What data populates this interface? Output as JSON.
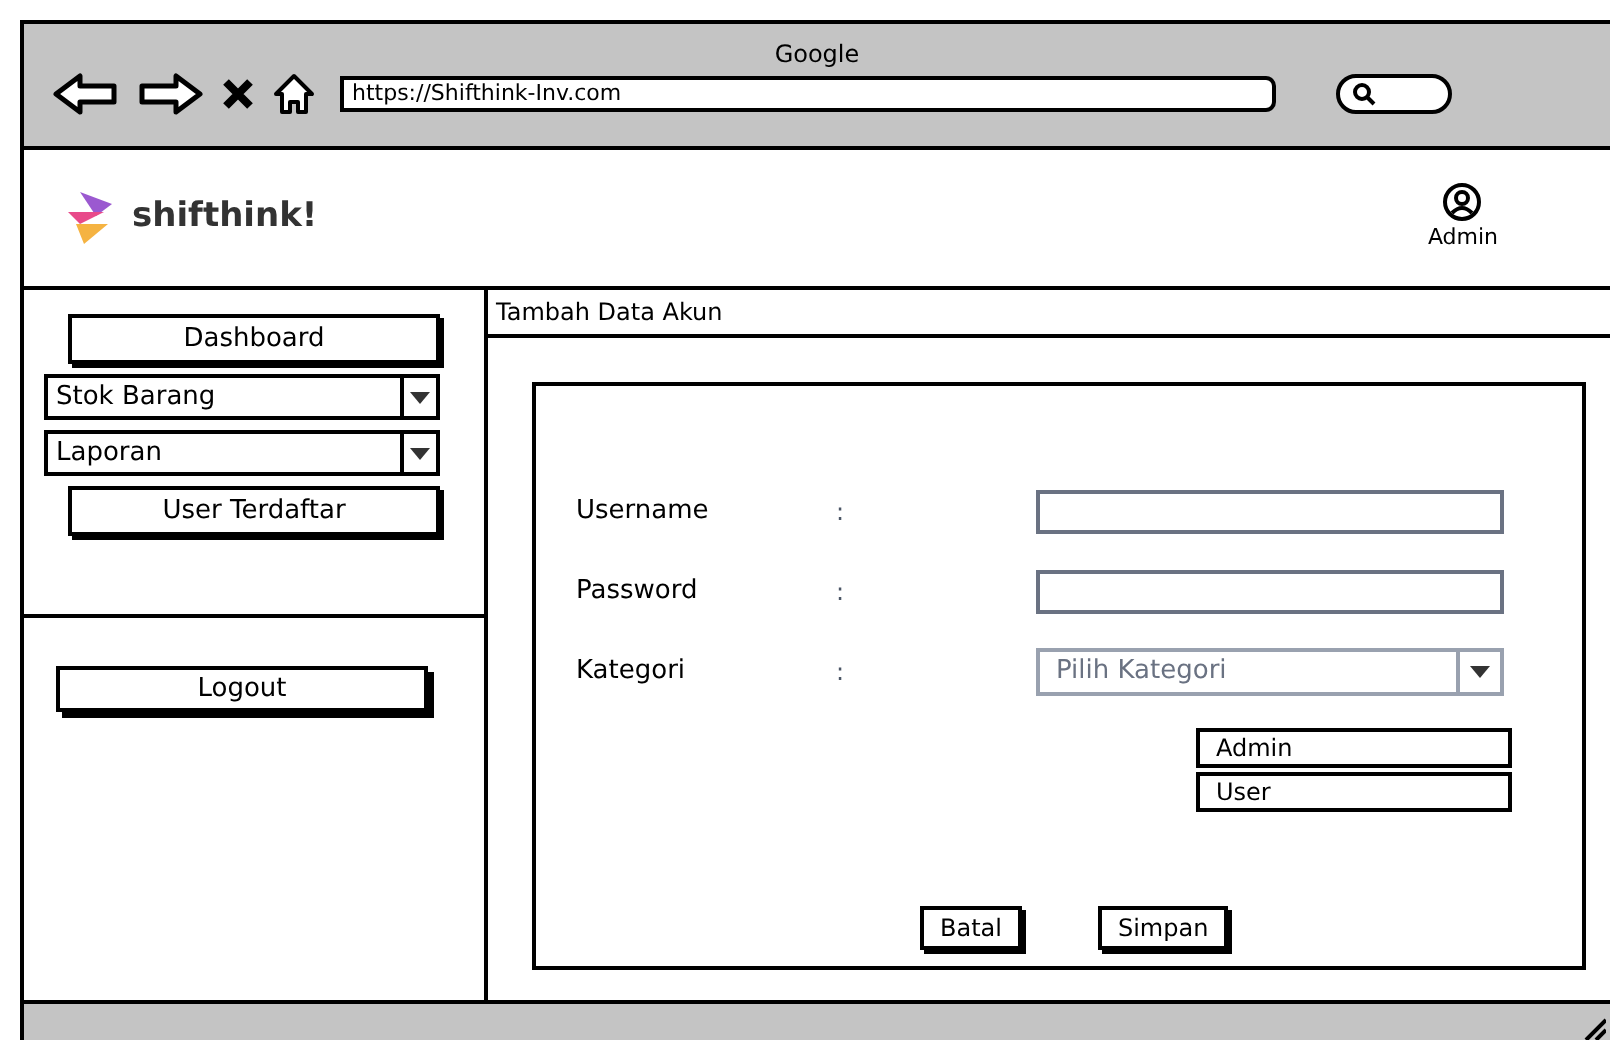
{
  "browser": {
    "title": "Google",
    "url": "https://Shifthink-Inv.com"
  },
  "header": {
    "brand": "shifthink!",
    "user": "Admin"
  },
  "sidebar": {
    "items": [
      {
        "kind": "button",
        "label": "Dashboard"
      },
      {
        "kind": "dropdown",
        "label": "Stok Barang"
      },
      {
        "kind": "dropdown",
        "label": "Laporan"
      },
      {
        "kind": "button",
        "label": "User Terdaftar"
      }
    ],
    "logout": "Logout"
  },
  "page_title": "Tambah Data Akun",
  "form": {
    "fields": [
      {
        "kind": "text",
        "label": "Username",
        "colon": ":"
      },
      {
        "kind": "text",
        "label": "Password",
        "colon": ":"
      },
      {
        "kind": "select",
        "label": "Kategori",
        "colon": ":",
        "placeholder": "Pilih Kategori",
        "options": [
          "Admin",
          "User"
        ]
      }
    ],
    "buttons": [
      "Batal",
      "Simpan"
    ]
  }
}
